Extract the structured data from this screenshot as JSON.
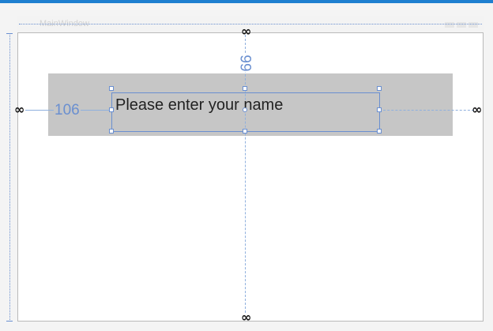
{
  "window": {
    "title": "MainWindow"
  },
  "textbox": {
    "text": "Please enter your name"
  },
  "margins": {
    "left": "106",
    "top": "99"
  },
  "colors": {
    "accent": "#1e7fd0",
    "guide": "#6a8fd0",
    "band": "#c6c6c6"
  },
  "icons": {
    "top_anchor": "link-icon",
    "bottom_anchor": "link-icon",
    "left_anchor": "link-icon",
    "right_anchor": "broken-link-icon"
  }
}
